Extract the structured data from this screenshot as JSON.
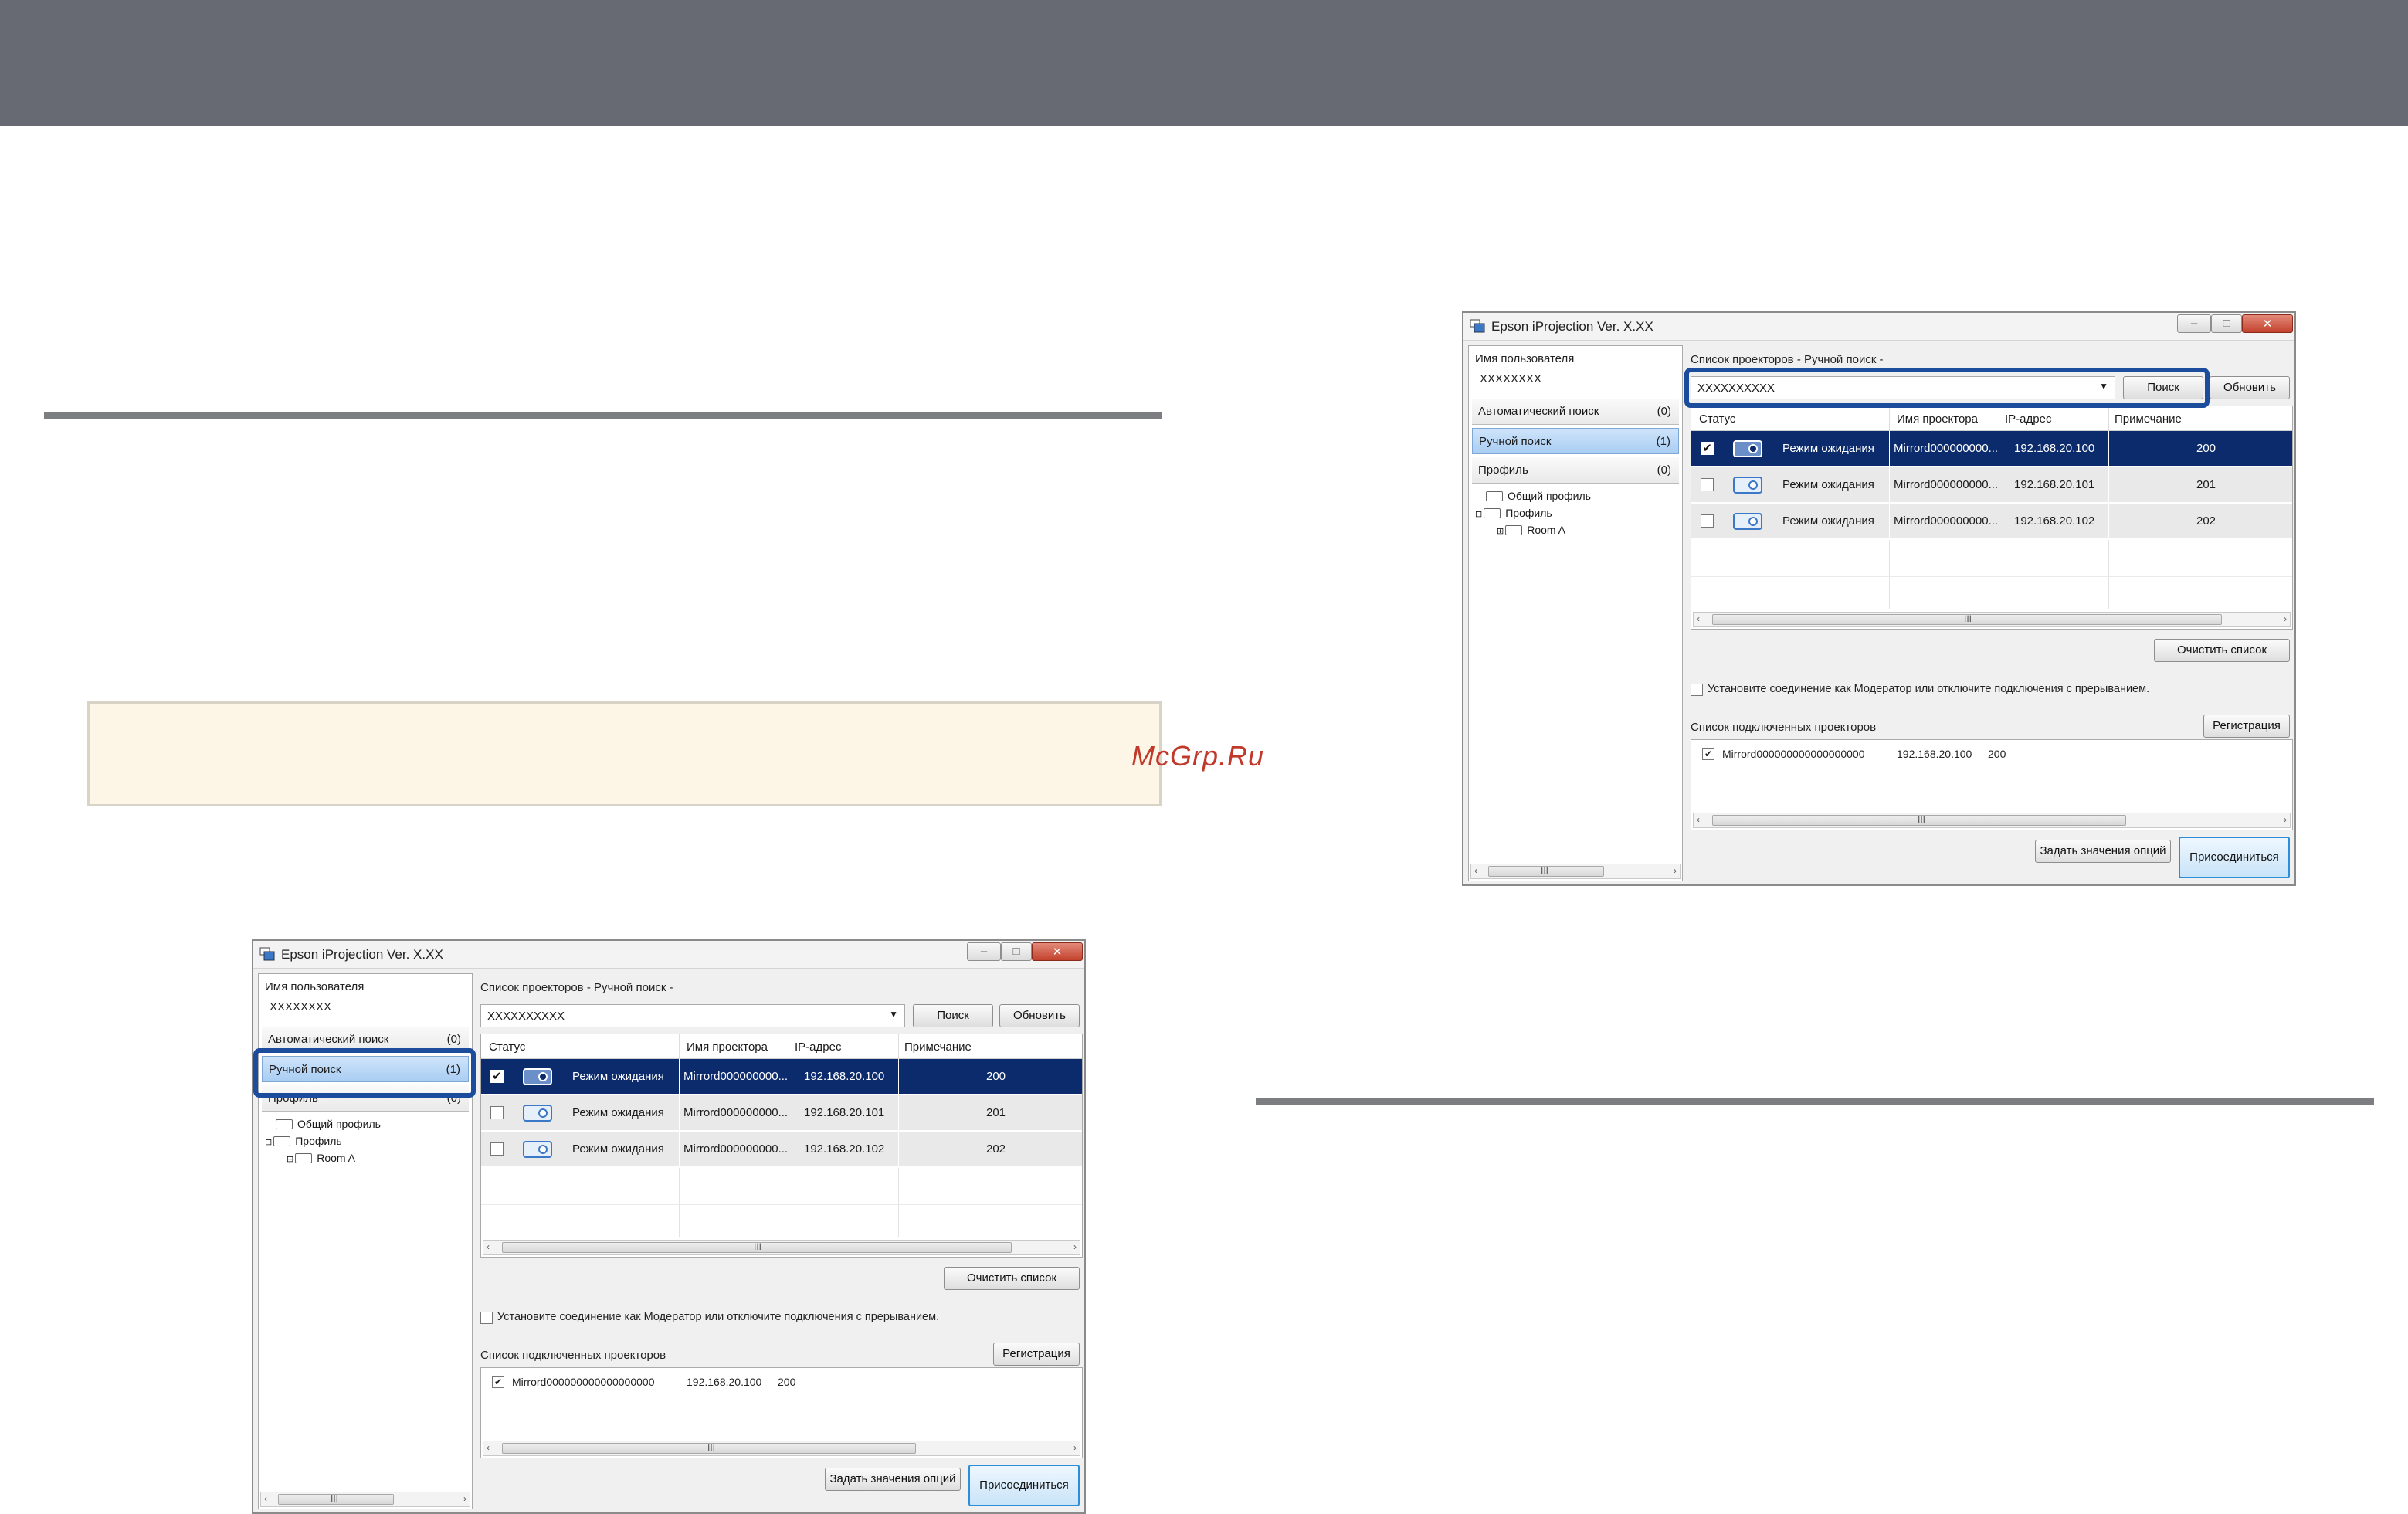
{
  "watermark": "McGrp.Ru",
  "window": {
    "title": "Epson iProjection Ver. X.XX",
    "username_label": "Имя пользователя",
    "username_value": "XXXXXXXX",
    "nav": [
      {
        "label": "Автоматический поиск",
        "count": "(0)"
      },
      {
        "label": "Ручной поиск",
        "count": "(1)"
      },
      {
        "label": "Профиль",
        "count": "(0)"
      }
    ],
    "tree": {
      "common_profile": "Общий профиль",
      "profile": "Профиль",
      "room": "Room A"
    },
    "list_title": "Список проекторов - Ручной поиск -",
    "search_value": "XXXXXXXXXX",
    "search_button": "Поиск",
    "refresh_button": "Обновить",
    "columns": {
      "status": "Статус",
      "projector_name": "Имя проектора",
      "ip": "IP-адрес",
      "note": "Примечание"
    },
    "rows": [
      {
        "checked": "✔",
        "status": "Режим ожидания",
        "name": "Mirrord000000000...",
        "ip": "192.168.20.100",
        "note": "200"
      },
      {
        "checked": "",
        "status": "Режим ожидания",
        "name": "Mirrord000000000...",
        "ip": "192.168.20.101",
        "note": "201"
      },
      {
        "checked": "",
        "status": "Режим ожидания",
        "name": "Mirrord000000000...",
        "ip": "192.168.20.102",
        "note": "202"
      }
    ],
    "clear_list_button": "Очистить список",
    "moderator_checkbox": "Установите соединение как Модератор или отключите подключения с прерыванием.",
    "connected_title": "Список подключенных проекторов",
    "register_button": "Регистрация",
    "connected_entry": {
      "check": "✔",
      "name": "Mirrord000000000000000000",
      "ip": "192.168.20.100",
      "note": "200"
    },
    "options_button": "Задать значения опций",
    "join_button": "Присоединиться",
    "scroll_mark": "III",
    "scroll_left": "‹",
    "scroll_right": "›",
    "min_glyph": "–",
    "max_glyph": "□",
    "close_glyph": "✕"
  }
}
